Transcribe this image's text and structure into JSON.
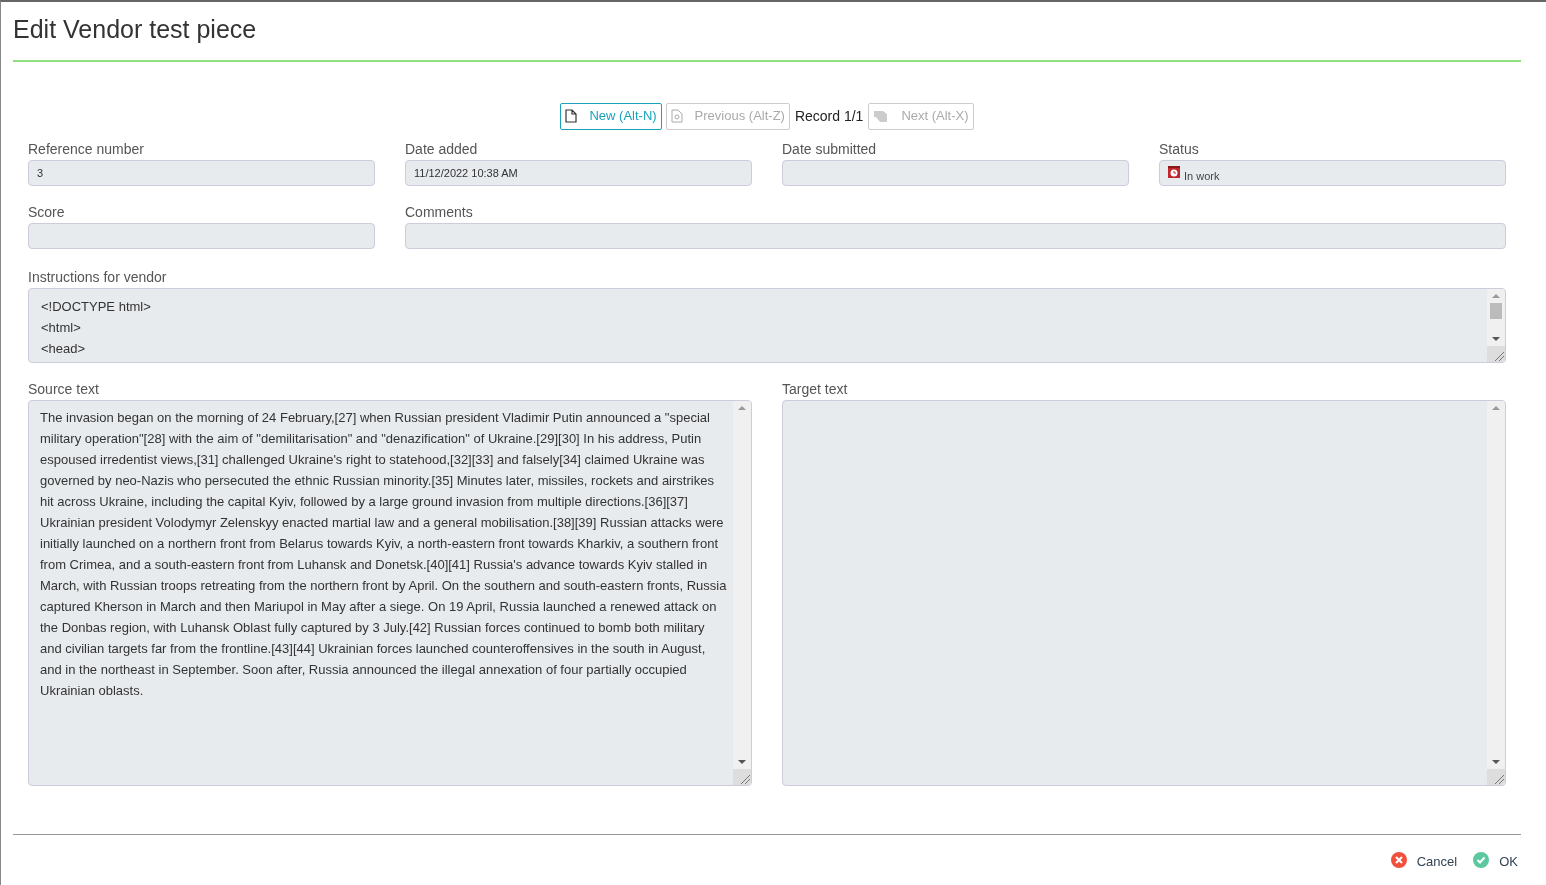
{
  "window": {
    "title": "Edit Vendor test piece"
  },
  "toolbar": {
    "buttons": [
      {
        "kind": "new",
        "label": "New (Alt-N)",
        "disabled": false
      },
      {
        "kind": "previous",
        "label": "Previous (Alt-Z)",
        "disabled": true
      }
    ],
    "record": "Record 1/1",
    "after": [
      {
        "kind": "next",
        "label": "Next (Alt-X)",
        "disabled": true
      }
    ]
  },
  "fields": [
    {
      "kind": "text",
      "label": "Reference number",
      "value": "3"
    },
    {
      "kind": "text",
      "label": "Date added",
      "value": "11/12/2022 10:38 AM"
    },
    {
      "kind": "text",
      "label": "Date submitted"
    },
    {
      "kind": "status",
      "label": "Status",
      "value": "In work"
    },
    {
      "kind": "text",
      "label": "Score"
    },
    {
      "kind": "long_text",
      "label": "Comments"
    }
  ],
  "instructions": {
    "label": "Instructions for vendor",
    "lines": [
      "<!DOCTYPE html>",
      "<html>",
      "<head>"
    ]
  },
  "source": {
    "label": "Source text",
    "value": "The invasion began on the morning of 24 February,[27] when Russian president Vladimir Putin announced a \"special military operation\"[28] with the aim of \"demilitarisation\" and \"denazification\" of Ukraine.[29][30] In his address, Putin espoused irredentist views,[31] challenged Ukraine's right to statehood,[32][33] and falsely[34] claimed Ukraine was governed by neo-Nazis who persecuted the ethnic Russian minority.[35] Minutes later, missiles, rockets and airstrikes hit across Ukraine, including the capital Kyiv, followed by a large ground invasion from multiple directions.[36][37] Ukrainian president Volodymyr Zelenskyy enacted martial law and a general mobilisation.[38][39] Russian attacks were initially launched on a northern front from Belarus towards Kyiv, a north-eastern front towards Kharkiv, a southern front from Crimea, and a south-eastern front from Luhansk and Donetsk.[40][41] Russia's advance towards Kyiv stalled in March, with Russian troops retreating from the northern front by April. On the southern and south-eastern fronts, Russia captured Kherson in March and then Mariupol in May after a siege. On 19 April, Russia launched a renewed attack on the Donbas region, with Luhansk Oblast fully captured by 3 July.[42] Russian forces continued to bomb both military and civilian targets far from the frontline.[43][44] Ukrainian forces launched counteroffensives in the south in August, and in the northeast in September. Soon after, Russia announced the illegal annexation of four partially occupied Ukrainian oblasts."
  },
  "target": {
    "label": "Target text"
  },
  "footer": [
    {
      "kind": "cancel",
      "label": "Cancel"
    },
    {
      "kind": "ok",
      "label": "OK"
    }
  ]
}
